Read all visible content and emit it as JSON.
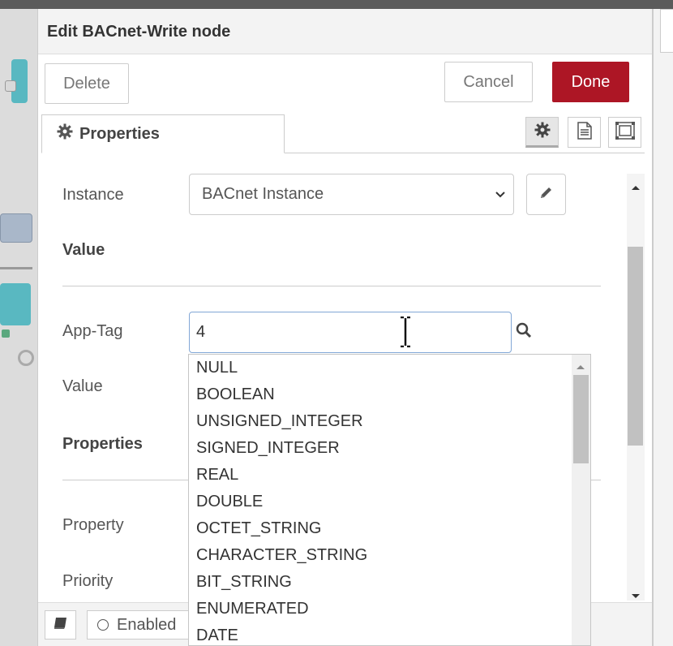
{
  "tray": {
    "title": "Edit BACnet-Write node",
    "delete_label": "Delete",
    "cancel_label": "Cancel",
    "done_label": "Done",
    "done_color": "#ad1625",
    "tab_label": "Properties",
    "tab_icons": [
      "gear-icon",
      "file-text-icon",
      "node-appearance-icon"
    ]
  },
  "form": {
    "instance_label": "Instance",
    "instance_value": "BACnet Instance",
    "value_section": "Value",
    "apptag_label": "App-Tag",
    "apptag_value": "4",
    "value_label": "Value",
    "properties_section": "Properties",
    "property_label": "Property",
    "priority_label": "Priority"
  },
  "apptag_dropdown": {
    "options": [
      "NULL",
      "BOOLEAN",
      "UNSIGNED_INTEGER",
      "SIGNED_INTEGER",
      "REAL",
      "DOUBLE",
      "OCTET_STRING",
      "CHARACTER_STRING",
      "BIT_STRING",
      "ENUMERATED",
      "DATE"
    ]
  },
  "footer": {
    "enabled_label": "Enabled"
  }
}
